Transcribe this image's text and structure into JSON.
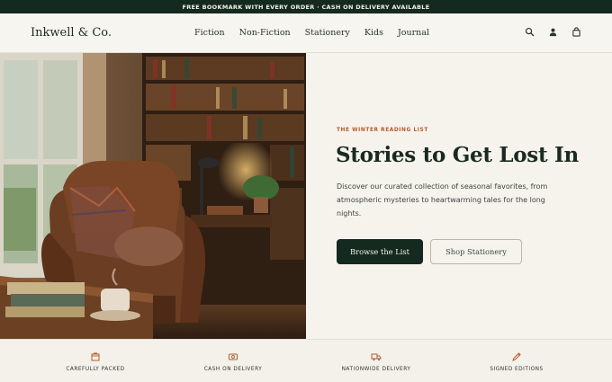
{
  "announcement": {
    "text": "FREE BOOKMARK WITH EVERY ORDER · CASH ON DELIVERY AVAILABLE"
  },
  "header": {
    "logo": "Inkwell & Co.",
    "nav": [
      "Fiction",
      "Non-Fiction",
      "Stationery",
      "Kids",
      "Journal"
    ],
    "icons": [
      "search-icon",
      "account-icon",
      "cart-icon"
    ]
  },
  "hero": {
    "image_alt": "cozy reading chair by a window with bookshelves",
    "eyebrow": "THE WINTER READING LIST",
    "headline": "Stories to Get Lost In",
    "subcopy": "Discover our curated collection of seasonal favorites, from atmospheric mysteries to heartwarming tales for the long nights.",
    "primary_cta": "Browse the List",
    "secondary_cta": "Shop Stationery"
  },
  "features": [
    {
      "icon": "package-icon",
      "label": "CAREFULLY PACKED"
    },
    {
      "icon": "cash-icon",
      "label": "CASH ON DELIVERY"
    },
    {
      "icon": "truck-icon",
      "label": "NATIONWIDE DELIVERY"
    },
    {
      "icon": "pen-icon",
      "label": "SIGNED EDITIONS"
    }
  ],
  "colors": {
    "brand_dark": "#14291f",
    "accent": "#b35a2a",
    "background": "#f7f5ef"
  }
}
